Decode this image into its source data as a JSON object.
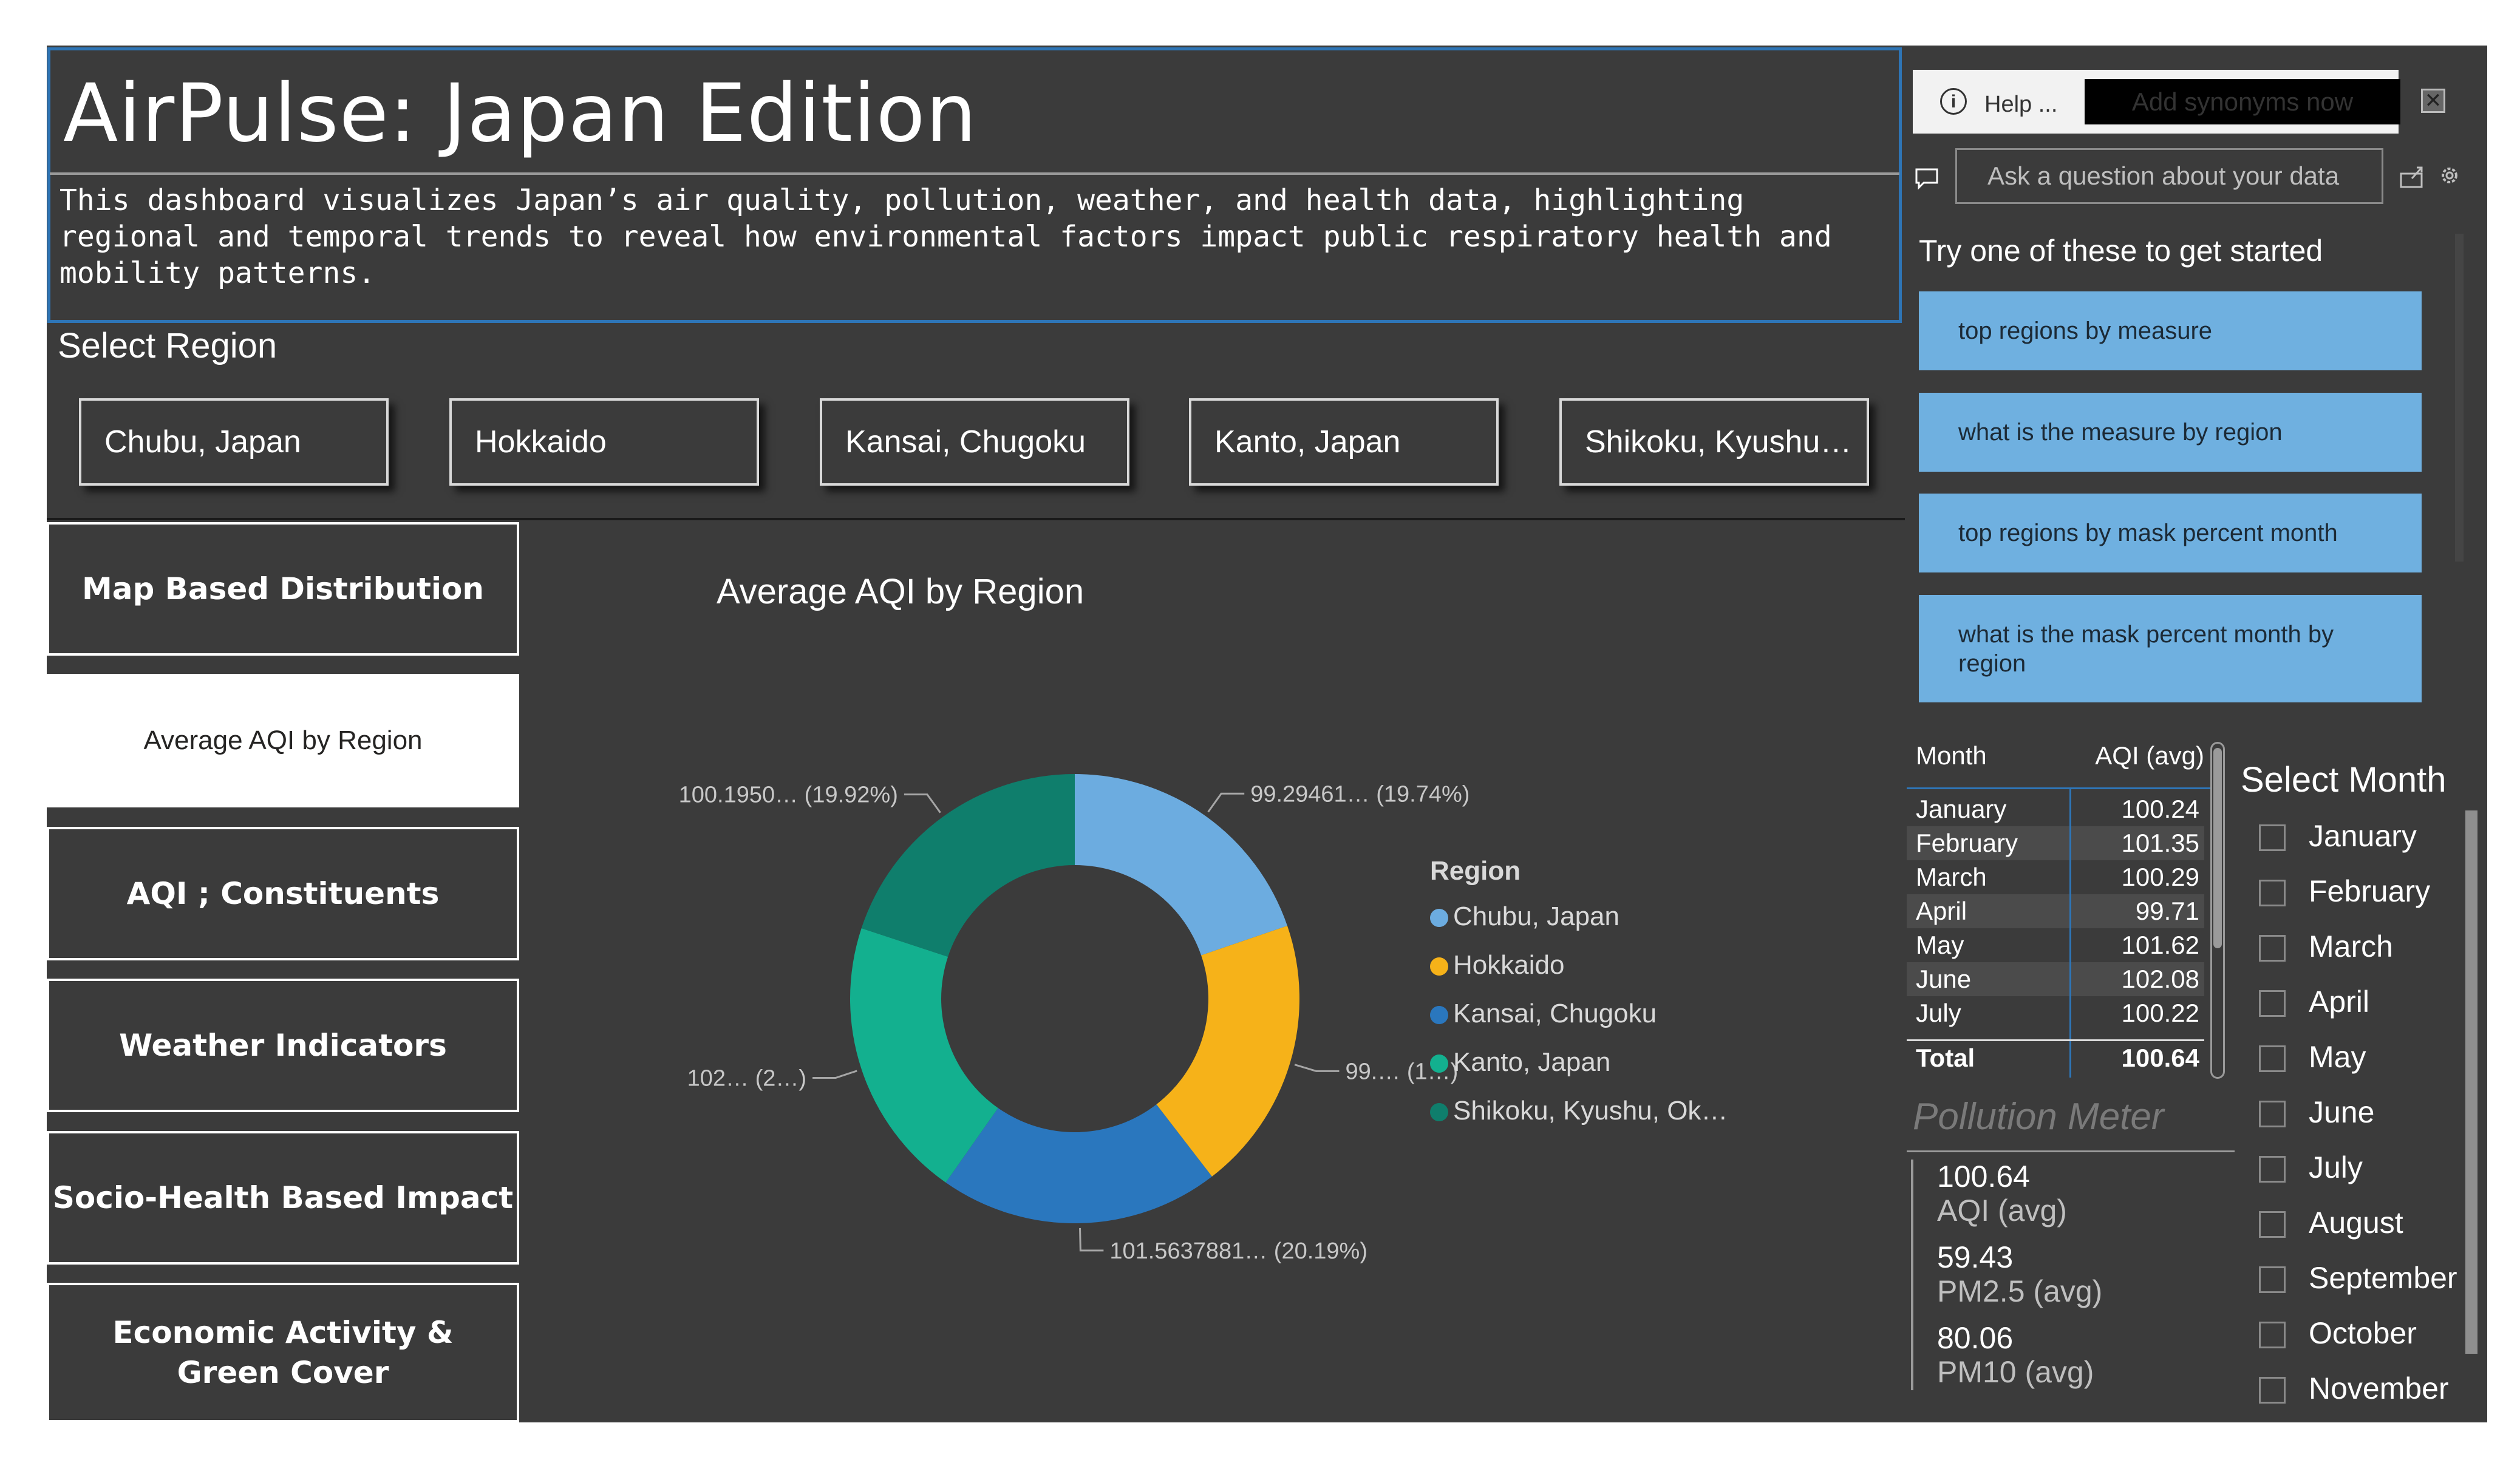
{
  "header": {
    "title": "AirPulse: Japan Edition",
    "description": "This dashboard visualizes Japan’s air quality, pollution, weather, and health data, highlighting regional and temporal trends to reveal how environmental factors impact public respiratory health and mobility patterns."
  },
  "region_slicer": {
    "label": "Select Region",
    "options": [
      "Chubu, Japan",
      "Hokkaido",
      "Kansai, Chugoku",
      "Kanto, Japan",
      "Shikoku, Kyushu…"
    ]
  },
  "navigation": [
    {
      "label": "Map Based Distribution",
      "active": false
    },
    {
      "label": "Average AQI by Region",
      "active": true
    },
    {
      "label": "AQI ; Constituents",
      "active": false
    },
    {
      "label": "Weather Indicators",
      "active": false
    },
    {
      "label": "Socio-Health Based Impact",
      "active": false
    },
    {
      "label": "Economic Activity & Green Cover",
      "active": false
    }
  ],
  "chart_data": {
    "type": "pie",
    "title": "Average AQI by Region",
    "legend_title": "Region",
    "legend_position": "right",
    "categories": [
      "Chubu, Japan",
      "Hokkaido",
      "Kansai, Chugoku",
      "Kanto, Japan",
      "Shikoku, Kyushu, Ok…"
    ],
    "values": [
      99.29,
      99.6,
      101.56,
      102.3,
      100.2
    ],
    "percentages": [
      19.74,
      19.8,
      20.19,
      20.35,
      19.92
    ],
    "colors": [
      "#6cace0",
      "#f6b219",
      "#2a77be",
      "#13b08f",
      "#0f7e6c"
    ],
    "data_labels": [
      "99.29461… (19.74%)",
      "99.… (1…)",
      "101.5637881… (20.19%)",
      "102… (2…)",
      "100.1950… (19.92%)"
    ]
  },
  "qa": {
    "help_label": "Help ...",
    "synonyms_button": "Add synonyms now",
    "input_placeholder": "Ask a question about your data",
    "hint": "Try one of these to get started",
    "suggestions": [
      "top regions by measure",
      "what is the measure by region",
      "top regions by mask percent month",
      "what is the mask percent month by region"
    ]
  },
  "month_table": {
    "columns": [
      "Month",
      "AQI (avg)"
    ],
    "rows": [
      {
        "month": "January",
        "aqi": "100.24"
      },
      {
        "month": "February",
        "aqi": "101.35"
      },
      {
        "month": "March",
        "aqi": "100.29"
      },
      {
        "month": "April",
        "aqi": "99.71"
      },
      {
        "month": "May",
        "aqi": "101.62"
      },
      {
        "month": "June",
        "aqi": "102.08"
      },
      {
        "month": "July",
        "aqi": "100.22"
      }
    ],
    "total_label": "Total",
    "total_value": "100.64"
  },
  "pollution_meter": {
    "title": "Pollution Meter",
    "metrics": [
      {
        "value": "100.64",
        "label": "AQI (avg)"
      },
      {
        "value": "59.43",
        "label": "PM2.5 (avg)"
      },
      {
        "value": "80.06",
        "label": "PM10 (avg)"
      }
    ]
  },
  "month_slicer": {
    "label": "Select Month",
    "options": [
      "January",
      "February",
      "March",
      "April",
      "May",
      "June",
      "July",
      "August",
      "September",
      "October",
      "November"
    ]
  }
}
